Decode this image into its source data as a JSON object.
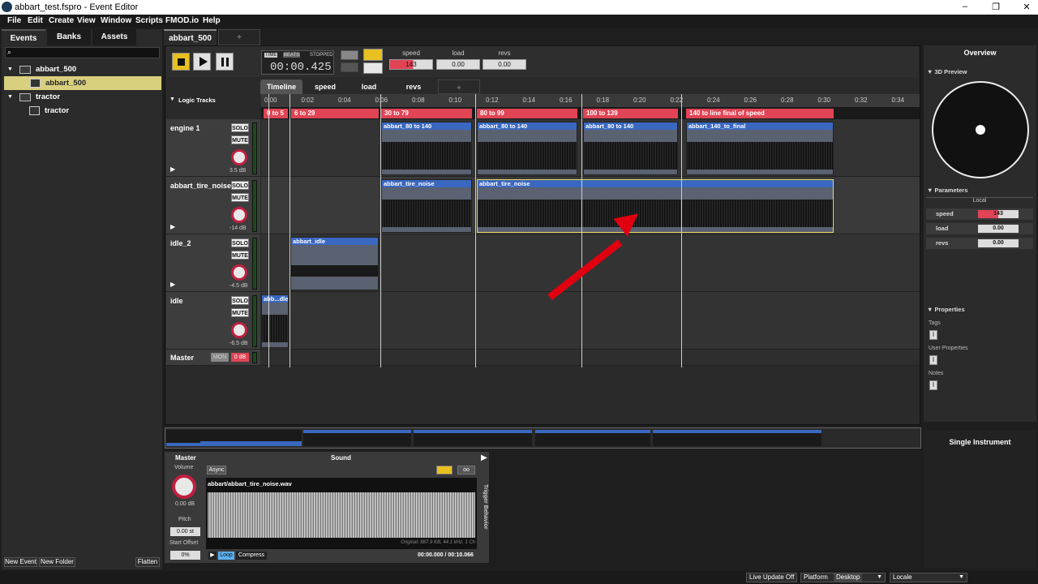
{
  "window": {
    "title": "abbart_test.fspro - Event Editor",
    "min": "–",
    "max": "❐",
    "close": "✕"
  },
  "menu": [
    "File",
    "Edit",
    "Create",
    "View",
    "Window",
    "Scripts",
    "FMOD.io",
    "Help"
  ],
  "left": {
    "tabs": [
      "Events",
      "Banks",
      "Assets"
    ],
    "tree": [
      {
        "label": "abbart_500",
        "type": "folder"
      },
      {
        "label": "abbart_500",
        "type": "event",
        "selected": true
      },
      {
        "label": "tractor",
        "type": "folder"
      },
      {
        "label": "tractor",
        "type": "event"
      }
    ],
    "buttons": [
      "New Event",
      "New Folder",
      "Flatten"
    ]
  },
  "editor": {
    "tab": "abbart_500",
    "add_tab": "+",
    "time_mode": [
      "TIME",
      "BEATS"
    ],
    "status": "STOPPED",
    "time": "00:00.425",
    "params": [
      {
        "name": "speed",
        "value": "143"
      },
      {
        "name": "load",
        "value": "0.00"
      },
      {
        "name": "revs",
        "value": "0.00"
      }
    ],
    "subtabs": [
      "Timeline",
      "speed",
      "load",
      "revs",
      "+"
    ],
    "logic_tracks": "Logic Tracks",
    "ruler": [
      "0:00",
      "0:02",
      "0:04",
      "0:06",
      "0:08",
      "0:10",
      "0:12",
      "0:14",
      "0:16",
      "0:18",
      "0:20",
      "0:22",
      "0:24",
      "0:26",
      "0:28",
      "0:30",
      "0:32",
      "0:34"
    ],
    "regions": [
      "0 to 5",
      "6 to 29",
      "30 to 79",
      "80 to 99",
      "100 to 139",
      "140 to line final of speed"
    ],
    "solo": "SOLO",
    "mute": "MUTE",
    "tracks": [
      {
        "name": "engine 1",
        "db": "3.5 dB",
        "clips": [
          "abbart_80 to 140",
          "abbart_80 to 140",
          "abbart_80 to 140",
          "abbart_140_to_final"
        ]
      },
      {
        "name": "abbart_tire_noise",
        "db": "-14 dB",
        "clips": [
          "abbart_tire_noise",
          "abbart_tire_noise"
        ]
      },
      {
        "name": "idle_2",
        "db": "-4.5 dB",
        "clips": [
          "abbart_idle"
        ]
      },
      {
        "name": "idle",
        "db": "-6.5 dB",
        "clips": [
          "abb...dle"
        ]
      }
    ],
    "master": {
      "name": "Master",
      "mon": "MON",
      "db": "0 dB"
    }
  },
  "right": {
    "overview": "Overview",
    "preview": "3D Preview",
    "parameters": "Parameters",
    "local": "Local",
    "params": [
      {
        "name": "speed",
        "value": "143"
      },
      {
        "name": "load",
        "value": "0.00"
      },
      {
        "name": "revs",
        "value": "0.00"
      }
    ],
    "properties": "Properties",
    "tags": "Tags",
    "user_props": "User Properties",
    "notes": "Notes",
    "instrument": "Single Instrument"
  },
  "bottom": {
    "master": "Master",
    "sound": "Sound",
    "volume": "Volume",
    "volume_db": "0.00 dB",
    "pitch": "Pitch",
    "pitch_val": "0.00 st",
    "start_offset": "Start Offset",
    "offset_val": "0%",
    "async": "Async",
    "loop_count": "oo",
    "file": "abbart/abbart_tire_noise.wav",
    "original": "Original: 887.9 KB, 44.1 kHz, 1 Ch",
    "timecode": "00:00.000 / 00:10.066",
    "loop": "Loop",
    "compress": "Compress",
    "trigger": "Trigger Behavior"
  },
  "status": {
    "live": "Live Update Off",
    "platform_lbl": "Platform",
    "platform": "Desktop",
    "locale": "Locale"
  },
  "colors": {
    "accent": "#e8c020",
    "region": "#e04455",
    "clip_header": "#3a68c0",
    "selected": "#d8d07e",
    "arrow": "#e00010"
  }
}
